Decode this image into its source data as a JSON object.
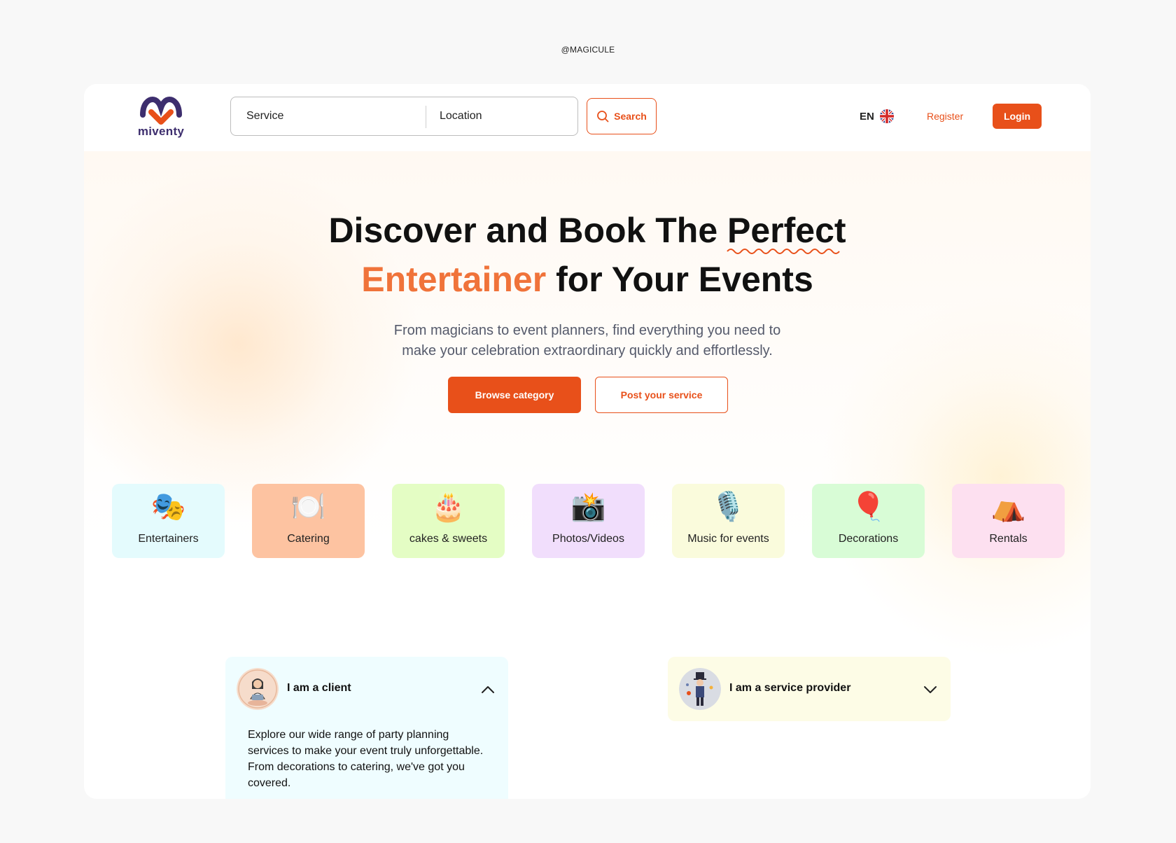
{
  "watermark": "@MAGICULE",
  "brand": {
    "name": "miventy",
    "accent_color": "#e8501a",
    "logo_purple": "#3d2e6e"
  },
  "header": {
    "search": {
      "service_placeholder": "Service",
      "location_placeholder": "Location",
      "button_label": "Search"
    },
    "language": "EN",
    "register_label": "Register",
    "login_label": "Login"
  },
  "hero": {
    "title_line1": "Discover and Book The Perfect",
    "title_accent": "Entertainer",
    "title_line2_rest": " for Your Events",
    "subtitle_line1": "From magicians to event planners, find everything you need to",
    "subtitle_line2": "make your celebration extraordinary quickly and effortlessly.",
    "browse_label": "Browse category",
    "post_label": "Post your service"
  },
  "categories": [
    {
      "label": "Entertainers",
      "icon": "theater-masks-icon",
      "glyph": "🎭",
      "bg": "#e4fbfd"
    },
    {
      "label": "Catering",
      "icon": "plate-cutlery-icon",
      "glyph": "🍽️",
      "bg": "#fdc3a1"
    },
    {
      "label": "cakes & sweets",
      "icon": "birthday-cake-icon",
      "glyph": "🎂",
      "bg": "#e4fdc4"
    },
    {
      "label": "Photos/Videos",
      "icon": "camera-flash-icon",
      "glyph": "📸",
      "bg": "#f1defc"
    },
    {
      "label": "Music for events",
      "icon": "microphone-icon",
      "glyph": "🎙️",
      "bg": "#fafbdc"
    },
    {
      "label": "Decorations",
      "icon": "balloon-icon",
      "glyph": "🎈",
      "bg": "#d8fcd6"
    },
    {
      "label": "Rentals",
      "icon": "tent-icon",
      "glyph": "⛺",
      "bg": "#fde0f0"
    }
  ],
  "roles": {
    "client": {
      "title": "I am a client",
      "expanded": true,
      "description": "Explore our wide range of party planning services to make your event truly unforgettable. From decorations to catering, we've got you covered."
    },
    "provider": {
      "title": "I am a service provider",
      "expanded": false
    }
  }
}
